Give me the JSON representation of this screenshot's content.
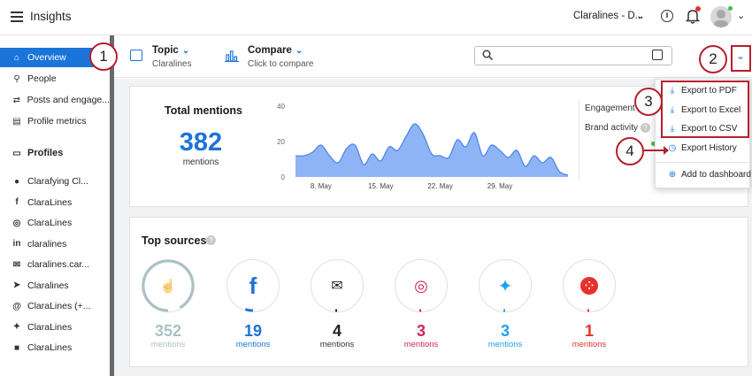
{
  "app": {
    "title": "Insights",
    "account_name": "Claralines - D..."
  },
  "sidebar": {
    "items": [
      {
        "label": "Overview",
        "icon": "home-icon",
        "glyph": "⌂"
      },
      {
        "label": "People",
        "icon": "person-icon",
        "glyph": "⚲"
      },
      {
        "label": "Posts and engage...",
        "icon": "repost-icon",
        "glyph": "⇄"
      },
      {
        "label": "Profile metrics",
        "icon": "chart-icon",
        "glyph": "▤"
      }
    ],
    "profiles_heading": "Profiles",
    "profiles": [
      {
        "label": "Clarafying Cl...",
        "icon": "apple-icon",
        "glyph": "●"
      },
      {
        "label": "ClaraLines",
        "icon": "facebook-icon",
        "glyph": "f"
      },
      {
        "label": "ClaraLines",
        "icon": "instagram-icon",
        "glyph": "◎"
      },
      {
        "label": "claralines",
        "icon": "linkedin-icon",
        "glyph": "in"
      },
      {
        "label": "claralines.car...",
        "icon": "mail-icon",
        "glyph": "✉"
      },
      {
        "label": "Claralines",
        "icon": "telegram-icon",
        "glyph": "➤"
      },
      {
        "label": "ClaraLines (+...",
        "icon": "threads-icon",
        "glyph": "@"
      },
      {
        "label": "ClaraLines",
        "icon": "twitter-icon",
        "glyph": "✦"
      },
      {
        "label": "ClaraLines",
        "icon": "profile-icon",
        "glyph": "■"
      }
    ]
  },
  "header": {
    "topic_label": "Topic",
    "topic_value": "Claralines",
    "compare_label": "Compare",
    "compare_sub": "Click to compare"
  },
  "total_mentions": {
    "title": "Total mentions",
    "value": "382",
    "unit": "mentions",
    "engagement_label": "Engagement",
    "brand_activity_label": "Brand activity"
  },
  "chart_data": {
    "type": "area",
    "title": "",
    "xlabel": "",
    "ylabel": "",
    "ylim": [
      0,
      40
    ],
    "yticks": [
      "0",
      "20",
      "40"
    ],
    "xticks": [
      "8. May",
      "15. May",
      "22. May",
      "29. May"
    ],
    "x": [
      0,
      1,
      2,
      3,
      4,
      5,
      6,
      7,
      8,
      9,
      10,
      11,
      12,
      13,
      14,
      15,
      16,
      17,
      18,
      19,
      20,
      21,
      22,
      23,
      24,
      25,
      26,
      27,
      28,
      29,
      30,
      31,
      32
    ],
    "values": [
      12,
      12,
      14,
      18,
      12,
      8,
      16,
      18,
      7,
      13,
      9,
      17,
      15,
      23,
      30,
      24,
      13,
      12,
      11,
      21,
      17,
      25,
      12,
      18,
      15,
      11,
      15,
      6,
      12,
      8,
      11,
      3,
      1
    ],
    "color": "#8fb4f5",
    "line_color": "#4f87ea",
    "grid": false
  },
  "top_sources": {
    "title": "Top sources",
    "items": [
      {
        "value": "352",
        "unit": "mentions",
        "icon": "thumbs-up-icon",
        "color": "#a9c1c6",
        "fraction": 0.92
      },
      {
        "value": "19",
        "unit": "mentions",
        "icon": "facebook-icon",
        "color": "#1b74d9",
        "fraction": 0.05
      },
      {
        "value": "4",
        "unit": "mentions",
        "icon": "mail-icon",
        "color": "#222222",
        "fraction": 0.01
      },
      {
        "value": "3",
        "unit": "mentions",
        "icon": "instagram-icon",
        "color": "#d0245c",
        "fraction": 0.01
      },
      {
        "value": "3",
        "unit": "mentions",
        "icon": "twitter-icon",
        "color": "#1da1f2",
        "fraction": 0.01
      },
      {
        "value": "1",
        "unit": "mentions",
        "icon": "foursquare-icon",
        "color": "#e5322d",
        "fraction": 0.003
      }
    ]
  },
  "menu": {
    "export_pdf": "Export to PDF",
    "export_excel": "Export to Excel",
    "export_csv": "Export to CSV",
    "export_history": "Export History",
    "add_dashboard": "Add to dashboard"
  },
  "callouts": [
    "1",
    "2",
    "3",
    "4"
  ],
  "colors": {
    "accent": "#1b74d9",
    "callout": "#b5202c"
  }
}
